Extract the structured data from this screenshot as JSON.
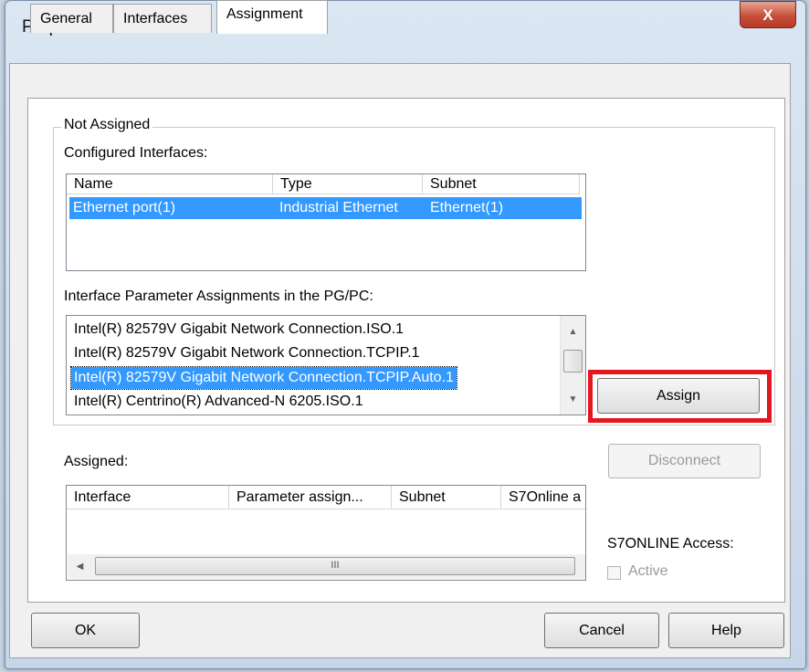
{
  "window": {
    "title": "Properties - PG/PC",
    "close_glyph": "X"
  },
  "tabs": [
    {
      "label": "General",
      "active": false
    },
    {
      "label": "Interfaces",
      "active": false
    },
    {
      "label": "Assignment",
      "active": true
    }
  ],
  "not_assigned": {
    "group_label": "Not Assigned",
    "configured_label": "Configured Interfaces:",
    "columns": [
      "Name",
      "Type",
      "Subnet"
    ],
    "rows": [
      {
        "name": "Ethernet port(1)",
        "type": "Industrial Ethernet",
        "subnet": "Ethernet(1)",
        "selected": true
      }
    ],
    "param_label": "Interface Parameter Assignments in the PG/PC:",
    "param_items": [
      {
        "label": "Intel(R) 82579V Gigabit Network Connection.ISO.1",
        "selected": false
      },
      {
        "label": "Intel(R) 82579V Gigabit Network Connection.TCPIP.1",
        "selected": false
      },
      {
        "label": "Intel(R) 82579V Gigabit Network Connection.TCPIP.Auto.1",
        "selected": true
      },
      {
        "label": "Intel(R) Centrino(R) Advanced-N 6205.ISO.1",
        "selected": false
      }
    ],
    "assign_label": "Assign"
  },
  "assigned": {
    "label": "Assigned:",
    "columns": [
      "Interface",
      "Parameter assign...",
      "Subnet",
      "S7Online a"
    ],
    "disconnect_label": "Disconnect",
    "scroll_grip": "III"
  },
  "s7online": {
    "label": "S7ONLINE Access:",
    "checkbox_label": "Active",
    "checked": false
  },
  "footer": {
    "ok_label": "OK",
    "cancel_label": "Cancel",
    "help_label": "Help"
  },
  "colors": {
    "selection": "#3399ff",
    "highlight_box": "#e3171f"
  },
  "icons": {
    "scroll_up": "▲",
    "scroll_down": "▼",
    "scroll_left": "◀",
    "scroll_right": "▶"
  }
}
